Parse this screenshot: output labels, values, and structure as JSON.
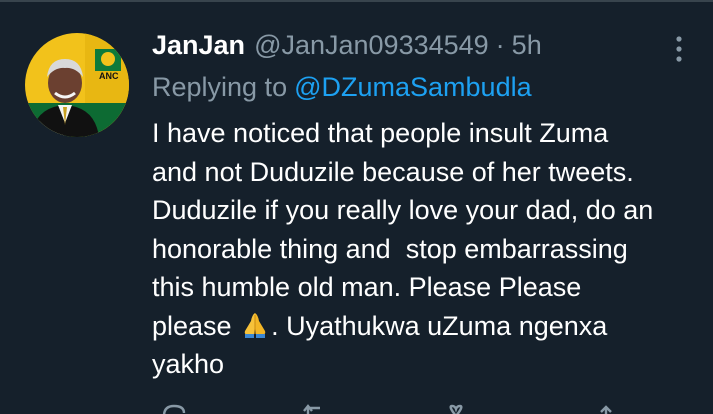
{
  "tweet": {
    "display_name": "JanJan",
    "handle": "@JanJan09334549",
    "separator": "·",
    "time": "5h",
    "replying_prefix": "Replying to",
    "replying_to": "@DZumaSambudla",
    "body_lines": [
      "I have noticed that people insult Zuma",
      "and not Duduzile because of her tweets.",
      "Duduzile if you really love your dad, do an",
      "honorable thing and  stop embarrassing",
      "this humble old man. Please Please",
      "please",
      ". Uyathukwa uZuma ngenxa",
      "yakho"
    ],
    "emoji": "folded-hands",
    "avatar_logo_text": "ANC"
  },
  "icons": {
    "more": "more-vertical-icon",
    "reply": "reply-icon",
    "retweet": "retweet-icon",
    "like": "like-icon",
    "share": "share-icon"
  },
  "colors": {
    "background": "#15202b",
    "primary_text": "#ffffff",
    "secondary_text": "#8899a6",
    "link": "#1da1f2"
  }
}
